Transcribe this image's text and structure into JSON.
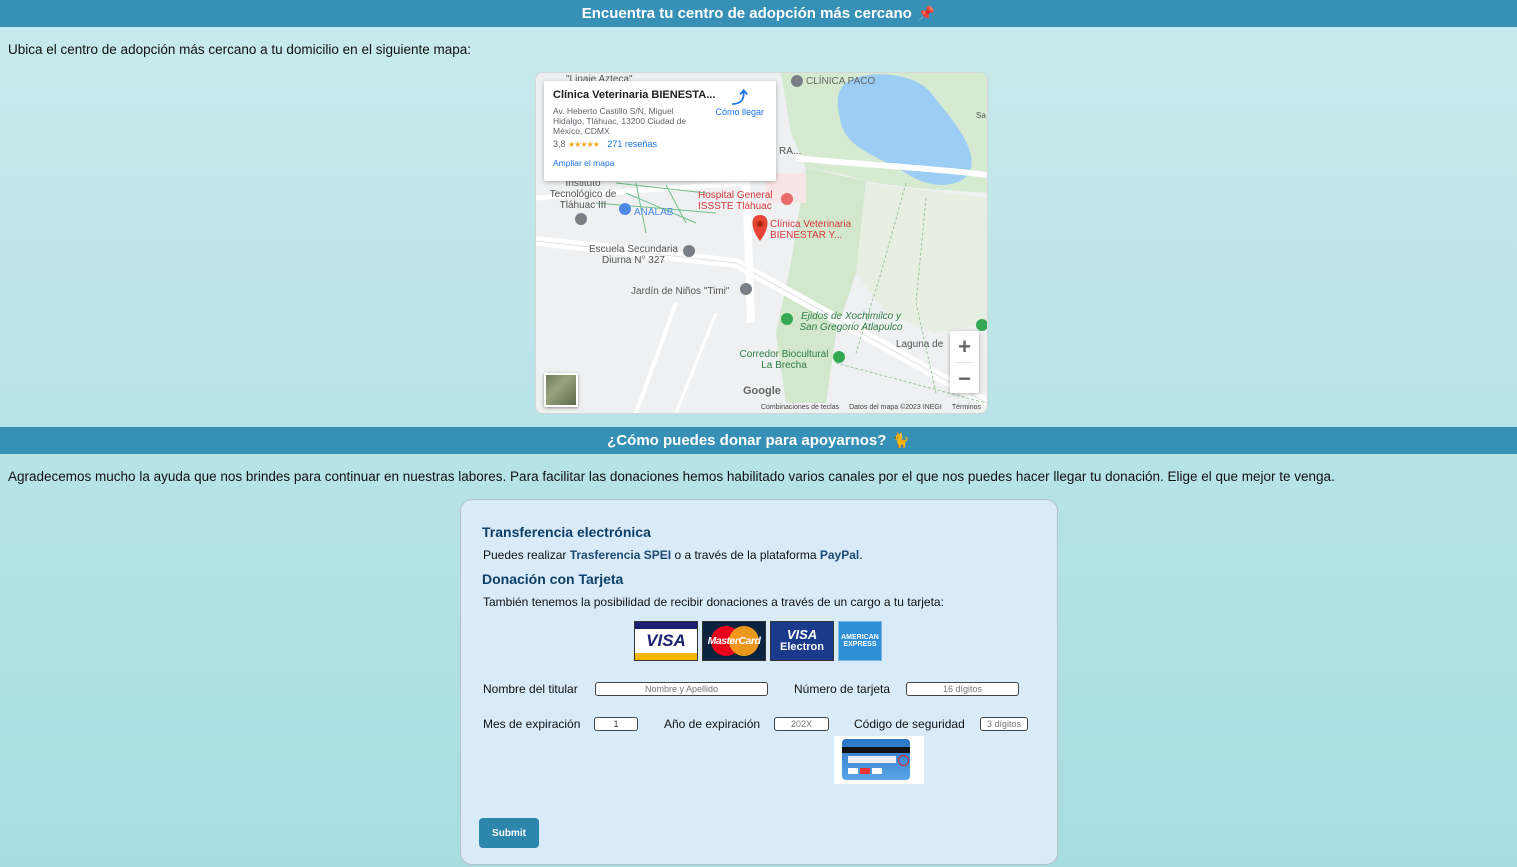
{
  "section1": {
    "title": "Encuentra tu centro de adopción más cercano",
    "emoji": "📌",
    "intro": "Ubica el centro de adopción más cercano a tu domicilio en el siguiente mapa:"
  },
  "map": {
    "place_name": "Clínica Veterinaria BIENESTA...",
    "address": "Av. Heberto Castillo S/N, Miguel Hidalgo, Tláhuac, 13200 Ciudad de México, CDMX",
    "rating": "3,8",
    "stars": "★★★★★",
    "reviews": "271 reseñas",
    "directions": "Cómo llegar",
    "enlarge": "Ampliar el mapa",
    "labels": {
      "linaje": "\"Linaje Azteca\"",
      "clinica_paco": "CLÍNICA PACO",
      "instituto": "Instituto Tecnológico de Tláhuac III",
      "analab": "ANALAB",
      "hospital": "Hospital General ISSSTE Tláhuac",
      "clinica_vet": "Clínica Veterinaria BIENESTAR Y...",
      "escuela": "Escuela Secundaria Diurna N° 327",
      "jardin": "Jardín de Niños \"Timi\"",
      "ejidos": "Ejidos de Xochimilco y San Gregorio Atlapulco",
      "corredor": "Corredor Biocultural La Brecha",
      "laguna": "Laguna de",
      "ra": "RA...",
      "sa": "Sa"
    },
    "zoom_in": "+",
    "zoom_out": "−",
    "google": "Google",
    "footer": [
      "Combinaciones de teclas",
      "Datos del mapa ©2023 INEGI",
      "Términos"
    ]
  },
  "section2": {
    "title": "¿Cómo puedes donar para apoyarnos?",
    "emoji": "🐈",
    "intro": "Agradecemos mucho la ayuda que nos brindes para continuar en nuestras labores. Para facilitar las donaciones hemos habilitado varios canales por el que nos puedes hacer llegar tu donación. Elige el que mejor te venga."
  },
  "donation": {
    "transfer_title": "Transferencia electrónica",
    "transfer_pre": "Puedes realizar ",
    "transfer_spei": "Trasferencia SPEI",
    "transfer_mid": " o a través de la plataforma ",
    "transfer_paypal": "PayPal",
    "transfer_end": ".",
    "card_title": "Donación con Tarjeta",
    "card_text": "También tenemos la posibilidad de recibir donaciones a través de un cargo a tu tarjeta:",
    "card_logos": {
      "visa": "VISA",
      "mastercard": "MasterCard",
      "visa_electron_1": "VISA",
      "visa_electron_2": "Electron",
      "amex_1": "AMERICAN",
      "amex_2": "EXPRESS"
    },
    "fields": {
      "holder_label": "Nombre del titular",
      "holder_placeholder": "Nombre y Apellido",
      "number_label": "Número de tarjeta",
      "number_placeholder": "16 dígitos",
      "month_label": "Mes de expiración",
      "month_value": "1",
      "year_label": "Año de expiración",
      "year_placeholder": "202X",
      "cvv_label": "Código de seguridad",
      "cvv_placeholder": "3 dígitos"
    },
    "submit": "Submit"
  }
}
